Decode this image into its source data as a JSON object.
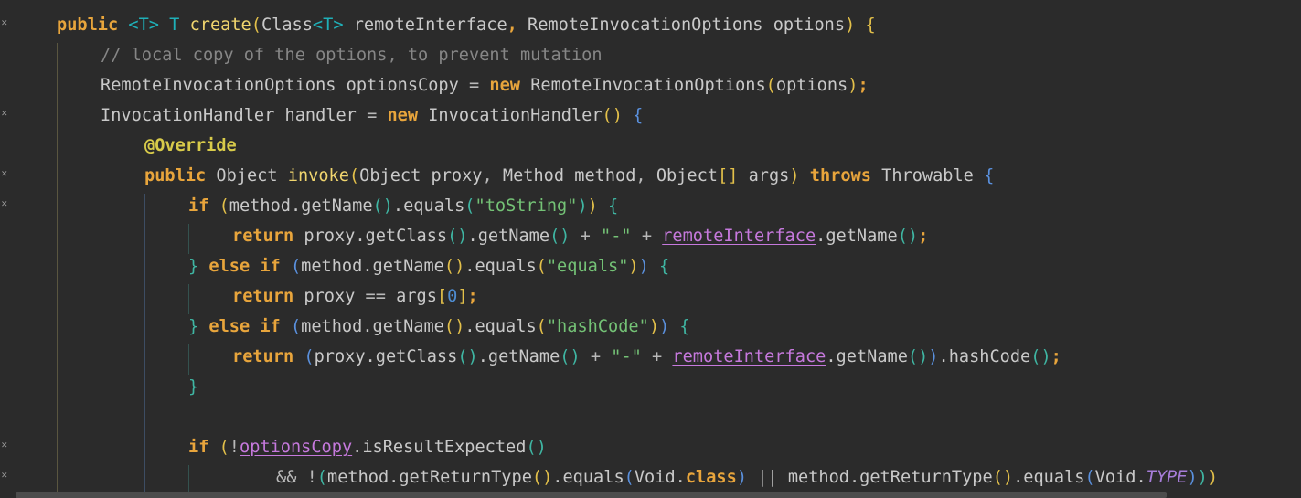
{
  "editor": {
    "lines": [
      [
        {
          "t": "public ",
          "c": "kw"
        },
        {
          "t": "<",
          "c": "generic"
        },
        {
          "t": "T",
          "c": "generic"
        },
        {
          "t": "> ",
          "c": "generic"
        },
        {
          "t": "T ",
          "c": "generic"
        },
        {
          "t": "create",
          "c": "fn"
        },
        {
          "t": "(",
          "c": "p-gold"
        },
        {
          "t": "Class",
          "c": "type"
        },
        {
          "t": "<",
          "c": "generic"
        },
        {
          "t": "T",
          "c": "generic"
        },
        {
          "t": "> ",
          "c": "generic"
        },
        {
          "t": "remoteInterface",
          "c": "plain"
        },
        {
          "t": ", ",
          "c": "kw"
        },
        {
          "t": "RemoteInvocationOptions ",
          "c": "type"
        },
        {
          "t": "options",
          "c": "plain"
        },
        {
          "t": ") ",
          "c": "p-gold"
        },
        {
          "t": "{",
          "c": "p-gold"
        }
      ],
      [
        {
          "t": "// local copy of the options, to prevent mutation",
          "c": "comment"
        }
      ],
      [
        {
          "t": "RemoteInvocationOptions ",
          "c": "type"
        },
        {
          "t": "optionsCopy ",
          "c": "plain"
        },
        {
          "t": "= ",
          "c": "op"
        },
        {
          "t": "new ",
          "c": "kw"
        },
        {
          "t": "RemoteInvocationOptions",
          "c": "type"
        },
        {
          "t": "(",
          "c": "p-gold"
        },
        {
          "t": "options",
          "c": "plain"
        },
        {
          "t": ")",
          "c": "p-gold"
        },
        {
          "t": ";",
          "c": "kw"
        }
      ],
      [
        {
          "t": "InvocationHandler ",
          "c": "type"
        },
        {
          "t": "handler ",
          "c": "plain"
        },
        {
          "t": "= ",
          "c": "op"
        },
        {
          "t": "new ",
          "c": "kw"
        },
        {
          "t": "InvocationHandler",
          "c": "type"
        },
        {
          "t": "() ",
          "c": "p-gold"
        },
        {
          "t": "{",
          "c": "p-blue"
        }
      ],
      [
        {
          "t": "@Override",
          "c": "anno"
        }
      ],
      [
        {
          "t": "public ",
          "c": "kw"
        },
        {
          "t": "Object ",
          "c": "type"
        },
        {
          "t": "invoke",
          "c": "fn"
        },
        {
          "t": "(",
          "c": "p-gold"
        },
        {
          "t": "Object ",
          "c": "type"
        },
        {
          "t": "proxy",
          "c": "plain"
        },
        {
          "t": ", ",
          "c": "op"
        },
        {
          "t": "Method ",
          "c": "type"
        },
        {
          "t": "method",
          "c": "plain"
        },
        {
          "t": ", ",
          "c": "op"
        },
        {
          "t": "Object",
          "c": "type"
        },
        {
          "t": "[] ",
          "c": "p-gold"
        },
        {
          "t": "args",
          "c": "plain"
        },
        {
          "t": ") ",
          "c": "p-gold"
        },
        {
          "t": "throws ",
          "c": "kw"
        },
        {
          "t": "Throwable ",
          "c": "type"
        },
        {
          "t": "{",
          "c": "p-blue"
        }
      ],
      [
        {
          "t": "if ",
          "c": "kw"
        },
        {
          "t": "(",
          "c": "p-gold"
        },
        {
          "t": "method.getName",
          "c": "plain"
        },
        {
          "t": "()",
          "c": "p-teal"
        },
        {
          "t": ".equals",
          "c": "plain"
        },
        {
          "t": "(",
          "c": "p-teal"
        },
        {
          "t": "\"toString\"",
          "c": "string"
        },
        {
          "t": ")",
          "c": "p-teal"
        },
        {
          "t": ") ",
          "c": "p-gold"
        },
        {
          "t": "{",
          "c": "p-teal"
        }
      ],
      [
        {
          "t": "return ",
          "c": "kw"
        },
        {
          "t": "proxy.getClass",
          "c": "plain"
        },
        {
          "t": "()",
          "c": "p-teal"
        },
        {
          "t": ".getName",
          "c": "plain"
        },
        {
          "t": "() ",
          "c": "p-teal"
        },
        {
          "t": "+ ",
          "c": "op"
        },
        {
          "t": "\"-\" ",
          "c": "string"
        },
        {
          "t": "+ ",
          "c": "op"
        },
        {
          "t": "remoteInterface",
          "c": "field"
        },
        {
          "t": ".getName",
          "c": "plain"
        },
        {
          "t": "()",
          "c": "p-teal"
        },
        {
          "t": ";",
          "c": "kw"
        }
      ],
      [
        {
          "t": "} ",
          "c": "p-teal"
        },
        {
          "t": "else if ",
          "c": "kw"
        },
        {
          "t": "(",
          "c": "p-blue"
        },
        {
          "t": "method.getName",
          "c": "plain"
        },
        {
          "t": "()",
          "c": "p-gold"
        },
        {
          "t": ".equals",
          "c": "plain"
        },
        {
          "t": "(",
          "c": "p-gold"
        },
        {
          "t": "\"equals\"",
          "c": "string"
        },
        {
          "t": ")",
          "c": "p-gold"
        },
        {
          "t": ") ",
          "c": "p-blue"
        },
        {
          "t": "{",
          "c": "p-teal"
        }
      ],
      [
        {
          "t": "return ",
          "c": "kw"
        },
        {
          "t": "proxy ",
          "c": "plain"
        },
        {
          "t": "== ",
          "c": "op"
        },
        {
          "t": "args",
          "c": "plain"
        },
        {
          "t": "[",
          "c": "p-gold"
        },
        {
          "t": "0",
          "c": "number"
        },
        {
          "t": "]",
          "c": "p-gold"
        },
        {
          "t": ";",
          "c": "kw"
        }
      ],
      [
        {
          "t": "} ",
          "c": "p-teal"
        },
        {
          "t": "else if ",
          "c": "kw"
        },
        {
          "t": "(",
          "c": "p-blue"
        },
        {
          "t": "method.getName",
          "c": "plain"
        },
        {
          "t": "()",
          "c": "p-gold"
        },
        {
          "t": ".equals",
          "c": "plain"
        },
        {
          "t": "(",
          "c": "p-gold"
        },
        {
          "t": "\"hashCode\"",
          "c": "string"
        },
        {
          "t": ")",
          "c": "p-gold"
        },
        {
          "t": ") ",
          "c": "p-blue"
        },
        {
          "t": "{",
          "c": "p-teal"
        }
      ],
      [
        {
          "t": "return ",
          "c": "kw"
        },
        {
          "t": "(",
          "c": "p-blue"
        },
        {
          "t": "proxy.getClass",
          "c": "plain"
        },
        {
          "t": "()",
          "c": "p-teal"
        },
        {
          "t": ".getName",
          "c": "plain"
        },
        {
          "t": "() ",
          "c": "p-teal"
        },
        {
          "t": "+ ",
          "c": "op"
        },
        {
          "t": "\"-\" ",
          "c": "string"
        },
        {
          "t": "+ ",
          "c": "op"
        },
        {
          "t": "remoteInterface",
          "c": "field"
        },
        {
          "t": ".getName",
          "c": "plain"
        },
        {
          "t": "()",
          "c": "p-teal"
        },
        {
          "t": ")",
          "c": "p-blue"
        },
        {
          "t": ".hashCode",
          "c": "plain"
        },
        {
          "t": "()",
          "c": "p-teal"
        },
        {
          "t": ";",
          "c": "kw"
        }
      ],
      [
        {
          "t": "}",
          "c": "p-teal"
        }
      ],
      [],
      [
        {
          "t": "if ",
          "c": "kw"
        },
        {
          "t": "(",
          "c": "p-gold"
        },
        {
          "t": "!",
          "c": "op"
        },
        {
          "t": "optionsCopy",
          "c": "field"
        },
        {
          "t": ".isResultExpected",
          "c": "plain"
        },
        {
          "t": "()",
          "c": "p-teal"
        }
      ],
      [
        {
          "t": "&& ",
          "c": "op"
        },
        {
          "t": "!",
          "c": "op"
        },
        {
          "t": "(",
          "c": "p-teal"
        },
        {
          "t": "method.getReturnType",
          "c": "plain"
        },
        {
          "t": "()",
          "c": "p-gold"
        },
        {
          "t": ".equals",
          "c": "plain"
        },
        {
          "t": "(",
          "c": "p-blue"
        },
        {
          "t": "Void.",
          "c": "type"
        },
        {
          "t": "class",
          "c": "kw"
        },
        {
          "t": ") ",
          "c": "p-blue"
        },
        {
          "t": "|| ",
          "c": "op"
        },
        {
          "t": "method.getReturnType",
          "c": "plain"
        },
        {
          "t": "()",
          "c": "p-gold"
        },
        {
          "t": ".equals",
          "c": "plain"
        },
        {
          "t": "(",
          "c": "p-blue"
        },
        {
          "t": "Void.",
          "c": "type"
        },
        {
          "t": "TYPE",
          "c": "italicconst"
        },
        {
          "t": ")",
          "c": "p-blue"
        },
        {
          "t": ")",
          "c": "p-teal"
        },
        {
          "t": ") ",
          "c": "p-gold"
        }
      ]
    ]
  }
}
